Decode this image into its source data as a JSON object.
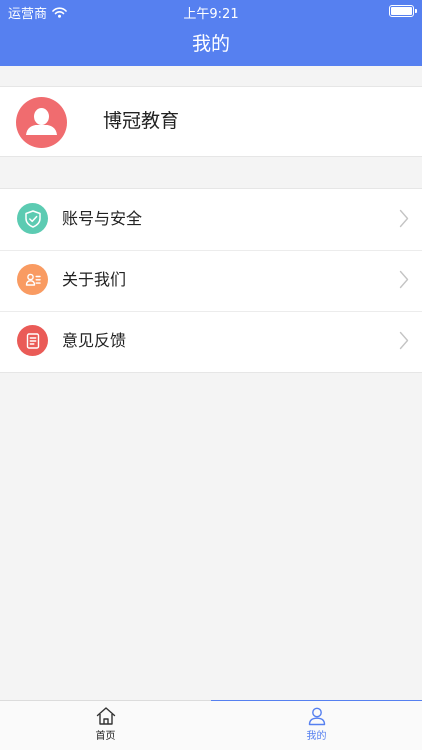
{
  "status_bar": {
    "carrier": "运营商",
    "time": "上午9:21"
  },
  "nav": {
    "title": "我的"
  },
  "profile": {
    "name": "博冠教育",
    "avatar_color": "#f06c6f"
  },
  "menu": {
    "items": [
      {
        "label": "账号与安全",
        "icon": "shield-check-icon",
        "color": "#5ccbb2"
      },
      {
        "label": "关于我们",
        "icon": "contact-card-icon",
        "color": "#f99b62"
      },
      {
        "label": "意见反馈",
        "icon": "feedback-document-icon",
        "color": "#ea5b57"
      }
    ]
  },
  "tab_bar": {
    "tabs": [
      {
        "label": "首页",
        "icon": "home-icon",
        "active": false
      },
      {
        "label": "我的",
        "icon": "user-icon",
        "active": true
      }
    ]
  },
  "colors": {
    "accent": "#5680f0",
    "background": "#f4f4f4"
  }
}
